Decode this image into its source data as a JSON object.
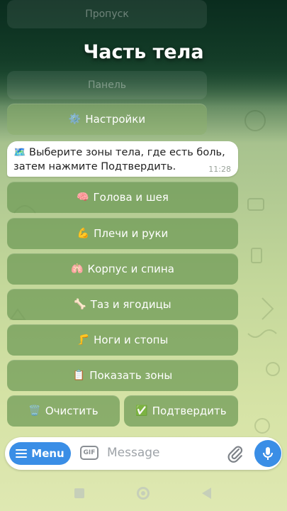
{
  "header": {
    "title": "Часть тела",
    "ghost_top": "Пропуск",
    "ghost_bottom": "Панель"
  },
  "settings_button": {
    "icon": "⚙️",
    "label": "Настройки"
  },
  "message": {
    "icon": "🗺️",
    "text": "Выберите зоны тела, где есть боль, затем нажмите Подтвердить.",
    "time": "11:28"
  },
  "keyboard": {
    "buttons": [
      {
        "icon": "🧠",
        "label": "Голова и шея"
      },
      {
        "icon": "💪",
        "label": "Плечи и руки"
      },
      {
        "icon": "🫁",
        "label": "Корпус и спина"
      },
      {
        "icon": "🦴",
        "label": "Таз и ягодицы"
      },
      {
        "icon": "🦵",
        "label": "Ноги и стопы"
      },
      {
        "icon": "📋",
        "label": "Показать зоны"
      }
    ],
    "clear": {
      "icon": "🗑️",
      "label": "Очистить"
    },
    "confirm": {
      "icon": "✅",
      "label": "Подтвердить"
    }
  },
  "input": {
    "menu_label": "Menu",
    "gif_label": "GIF",
    "placeholder": "Message"
  },
  "colors": {
    "accent": "#3a8ee6",
    "button_bg": "#6c9854",
    "header_bg": "#0e3a2a"
  }
}
